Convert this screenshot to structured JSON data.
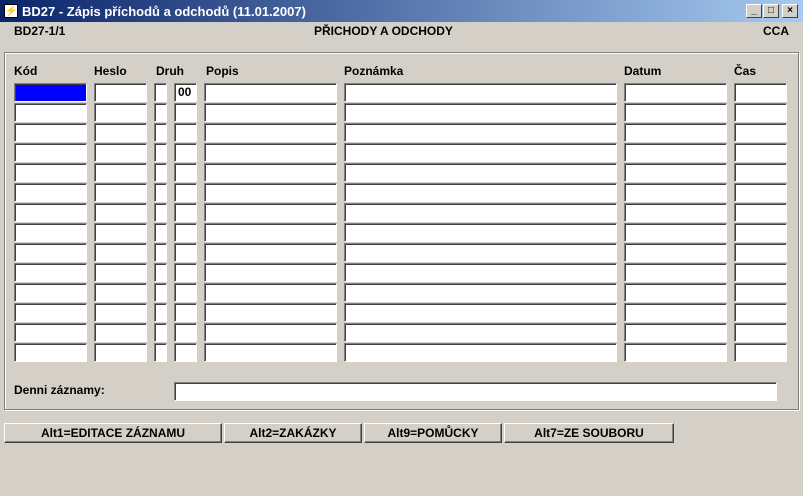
{
  "window": {
    "title": "BD27 - Zápis příchodů a odchodů (11.01.2007)",
    "controls": {
      "minimize": "_",
      "maximize": "□",
      "close": "×"
    }
  },
  "header": {
    "form_id": "BD27-1/1",
    "form_title": "PŘICHODY A ODCHODY",
    "user": "CCA"
  },
  "table": {
    "columns": {
      "kod": "Kód",
      "heslo": "Heslo",
      "druh": "Druh",
      "popis": "Popis",
      "poznamka": "Poznámka",
      "datum": "Datum",
      "cas": "Čas"
    },
    "row_count": 14,
    "first_row_druh_value": "00"
  },
  "daily": {
    "label": "Denni záznamy:",
    "value": ""
  },
  "buttons": {
    "edit": "Alt1=EDITACE ZÁZNAMU",
    "orders": "Alt2=ZAKÁZKY",
    "tools": "Alt9=POMŮCKY",
    "file": "Alt7=ZE SOUBORU"
  },
  "colors": {
    "active_cell": "#0000ff",
    "titlebar_start": "#0a246a",
    "titlebar_end": "#a6caf0",
    "face": "#d4d0c8"
  }
}
